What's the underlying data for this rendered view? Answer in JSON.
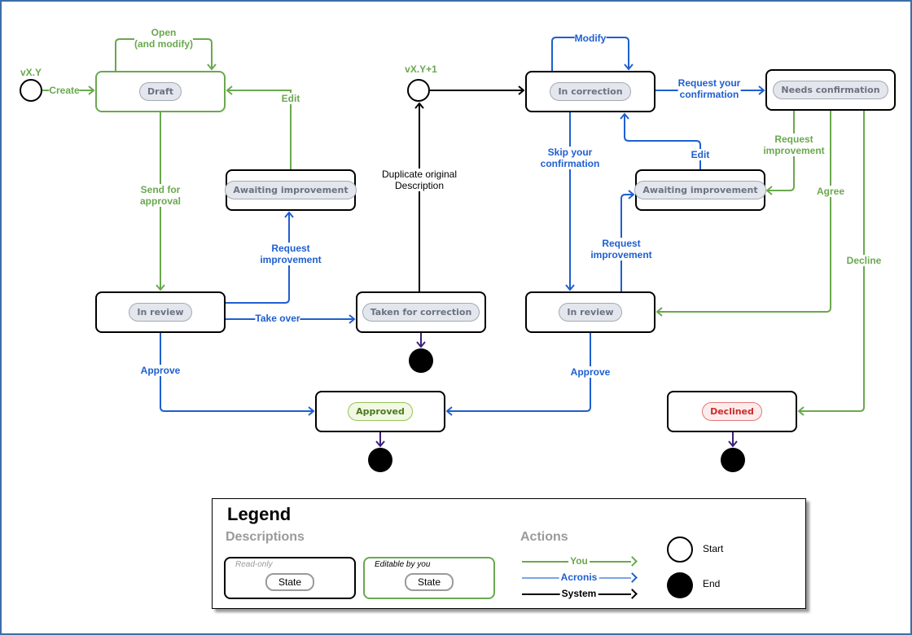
{
  "colors": {
    "you": "#6aa84f",
    "acronis": "#1f5fcf",
    "system": "#000000",
    "terminal": "#3b1f7a",
    "frame": "#3c6ea8"
  },
  "versions": {
    "initial": "vX.Y",
    "next": "vX.Y+1"
  },
  "states": {
    "draft": "Draft",
    "awaiting_left": "Awaiting improvement",
    "in_review_left": "In review",
    "taken": "Taken for correction",
    "approved": "Approved",
    "in_correction": "In correction",
    "needs_confirmation": "Needs confirmation",
    "awaiting_right": "Awaiting improvement",
    "in_review_right": "In review",
    "declined": "Declined"
  },
  "transitions": {
    "create": "Create",
    "open_modify": [
      "Open",
      "(and modify)"
    ],
    "edit_left": "Edit",
    "send_for_approval": [
      "Send for",
      "approval"
    ],
    "request_improvement_left": [
      "Request",
      "improvement"
    ],
    "take_over": "Take over",
    "approve_left": "Approve",
    "duplicate": [
      "Duplicate original",
      "Description"
    ],
    "modify": "Modify",
    "request_confirmation": [
      "Request your",
      "confirmation"
    ],
    "skip_confirmation": [
      "Skip your",
      "confirmation"
    ],
    "edit_right": "Edit",
    "request_improvement_green": [
      "Request",
      "improvement"
    ],
    "agree": "Agree",
    "request_improvement_right": [
      "Request",
      "improvement"
    ],
    "decline": "Decline",
    "approve_right": "Approve"
  },
  "legend": {
    "title": "Legend",
    "descriptions_title": "Descriptions",
    "read_only": "Read-only",
    "editable": "Editable by you",
    "state_label": "State",
    "actions_title": "Actions",
    "you": "You",
    "acronis": "Acronis",
    "system": "System",
    "start": "Start",
    "end": "End"
  }
}
